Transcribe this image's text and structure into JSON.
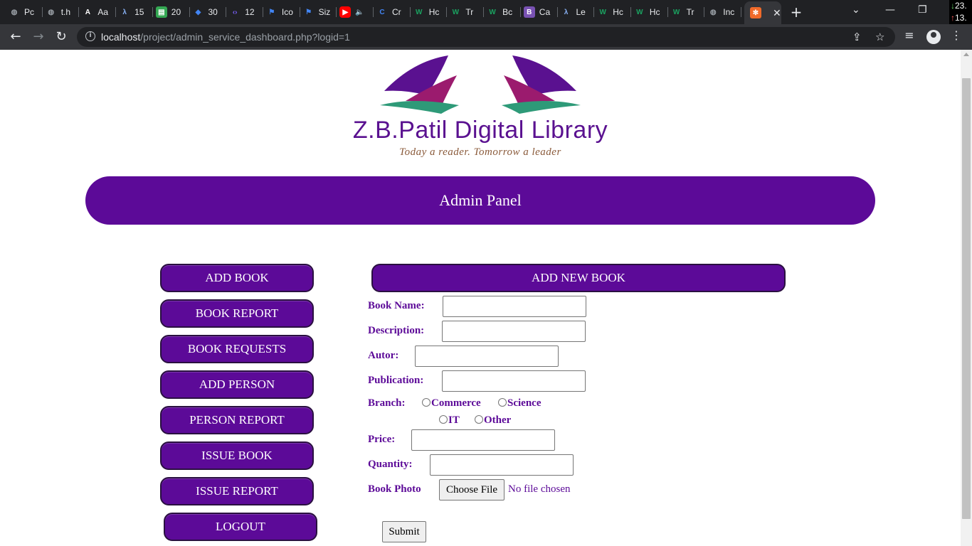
{
  "browser": {
    "tabs": [
      {
        "label": "Pc",
        "icon": "globe-icon",
        "color": "#9aa0a6"
      },
      {
        "label": "t.h",
        "icon": "globe-icon",
        "color": "#9aa0a6"
      },
      {
        "label": "Aa",
        "icon": "a-logo-icon",
        "color": "#ffffff"
      },
      {
        "label": "15",
        "icon": "lambda-icon",
        "color": "#8ab4f8"
      },
      {
        "label": "20",
        "icon": "sheet-icon",
        "color": "#34a853"
      },
      {
        "label": "30",
        "icon": "diamond-icon",
        "color": "#4285f4"
      },
      {
        "label": "12",
        "icon": "code-icon",
        "color": "#7b61ff"
      },
      {
        "label": "Ico",
        "icon": "flag-icon",
        "color": "#4285f4"
      },
      {
        "label": "Siz",
        "icon": "flag-icon",
        "color": "#4285f4"
      },
      {
        "label": "",
        "icon": "youtube-icon",
        "color": "#ff0000"
      },
      {
        "label": "Cr",
        "icon": "c-icon",
        "color": "#4285f4"
      },
      {
        "label": "Hc",
        "icon": "w-icon",
        "color": "#1aa260"
      },
      {
        "label": "Tr",
        "icon": "w-icon",
        "color": "#1aa260"
      },
      {
        "label": "Bc",
        "icon": "w-icon",
        "color": "#1aa260"
      },
      {
        "label": "Ca",
        "icon": "b-icon",
        "color": "#7952b3"
      },
      {
        "label": "Le",
        "icon": "lambda-icon",
        "color": "#8ab4f8"
      },
      {
        "label": "Hc",
        "icon": "w-icon",
        "color": "#1aa260"
      },
      {
        "label": "Hc",
        "icon": "w-icon",
        "color": "#1aa260"
      },
      {
        "label": "Tr",
        "icon": "w-icon",
        "color": "#1aa260"
      },
      {
        "label": "Inc",
        "icon": "globe-icon",
        "color": "#9aa0a6"
      }
    ],
    "net_down": "23.",
    "net_up": "13.",
    "url_host": "localhost",
    "url_path": "/project/admin_service_dashboard.php?logid=1"
  },
  "logo": {
    "title": "Z.B.Patil Digital Library",
    "tagline": "Today a reader. Tomorrow a leader",
    "colors": {
      "purple": "#5a1190",
      "magenta": "#9b1b6e",
      "teal": "#2e9a78"
    }
  },
  "banner": {
    "title": "Admin Panel"
  },
  "sidebar": {
    "items": [
      {
        "label": "ADD BOOK"
      },
      {
        "label": "BOOK REPORT"
      },
      {
        "label": "BOOK REQUESTS"
      },
      {
        "label": "ADD PERSON"
      },
      {
        "label": "PERSON REPORT"
      },
      {
        "label": "ISSUE BOOK"
      },
      {
        "label": "ISSUE REPORT"
      },
      {
        "label": "LOGOUT"
      }
    ]
  },
  "form": {
    "heading": "ADD NEW BOOK",
    "labels": {
      "book_name": "Book Name:",
      "description": "Description:",
      "author": "Autor:",
      "publication": "Publication:",
      "branch": "Branch:",
      "price": "Price:",
      "quantity": "Quantity:",
      "photo": "Book Photo"
    },
    "values": {
      "book_name": "",
      "description": "",
      "author": "",
      "publication": "",
      "price": "",
      "quantity": ""
    },
    "branch_options": [
      "Commerce",
      "Science",
      "IT",
      "Other"
    ],
    "file_button": "Choose File",
    "file_status": "No file chosen",
    "submit": "Submit"
  },
  "colors": {
    "accent": "#5c0a98",
    "button_border": "#2a1040"
  }
}
